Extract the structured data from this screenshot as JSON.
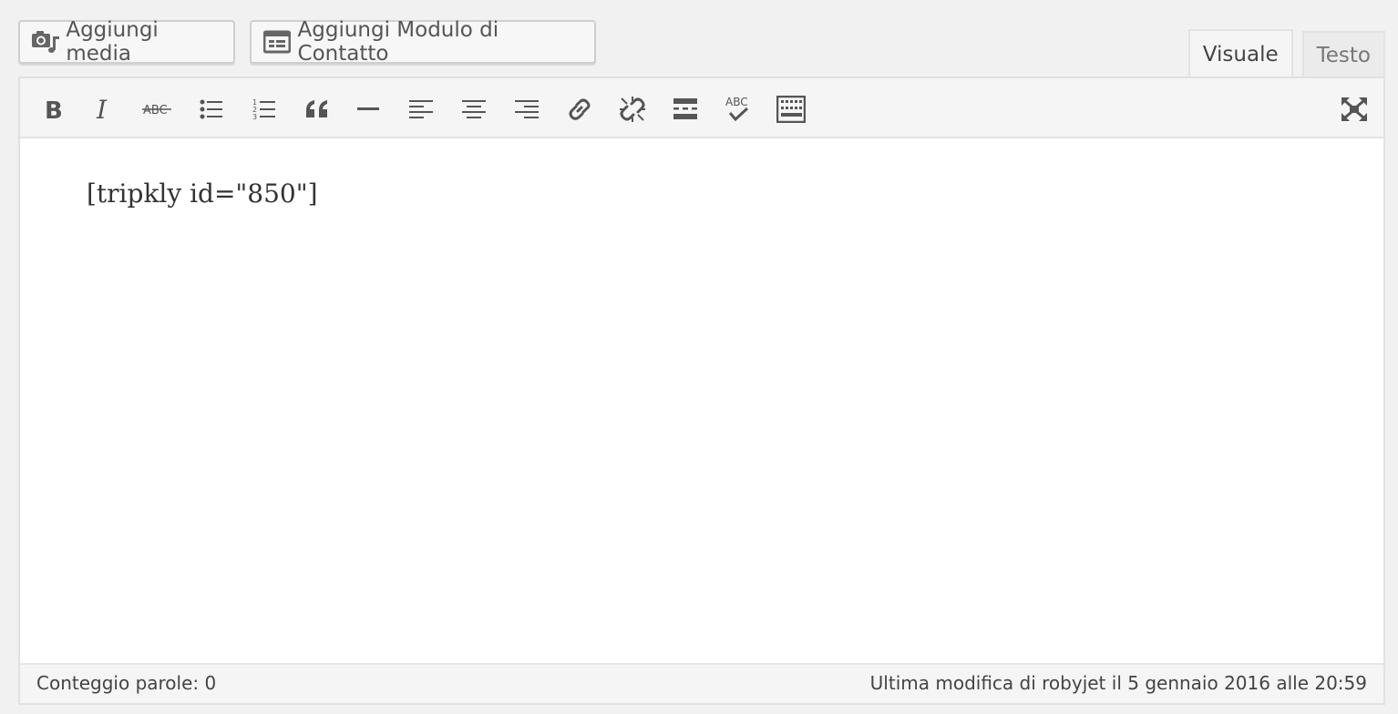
{
  "buttons": {
    "add_media": "Aggiungi media",
    "add_contact_form": "Aggiungi Modulo di Contatto"
  },
  "tabs": [
    {
      "label": "Visuale",
      "active": true
    },
    {
      "label": "Testo",
      "active": false
    }
  ],
  "toolbar": {
    "icons": [
      "bold-icon",
      "italic-icon",
      "strikethrough-icon",
      "bulleted-list-icon",
      "numbered-list-icon",
      "blockquote-icon",
      "horizontal-line-icon",
      "align-left-icon",
      "align-center-icon",
      "align-right-icon",
      "insert-link-icon",
      "remove-link-icon",
      "read-more-icon",
      "spellcheck-icon",
      "toolbar-toggle-icon",
      "fullscreen-icon"
    ]
  },
  "content": {
    "text": "[tripkly id=\"850\"]"
  },
  "status": {
    "word_count": "Conteggio parole: 0",
    "last_edit": "Ultima modifica di robyjet il 5 gennaio 2016 alle 20:59"
  },
  "colors": {
    "background": "#f1f1f1",
    "icon": "#555555",
    "editor_bg": "#ffffff"
  }
}
